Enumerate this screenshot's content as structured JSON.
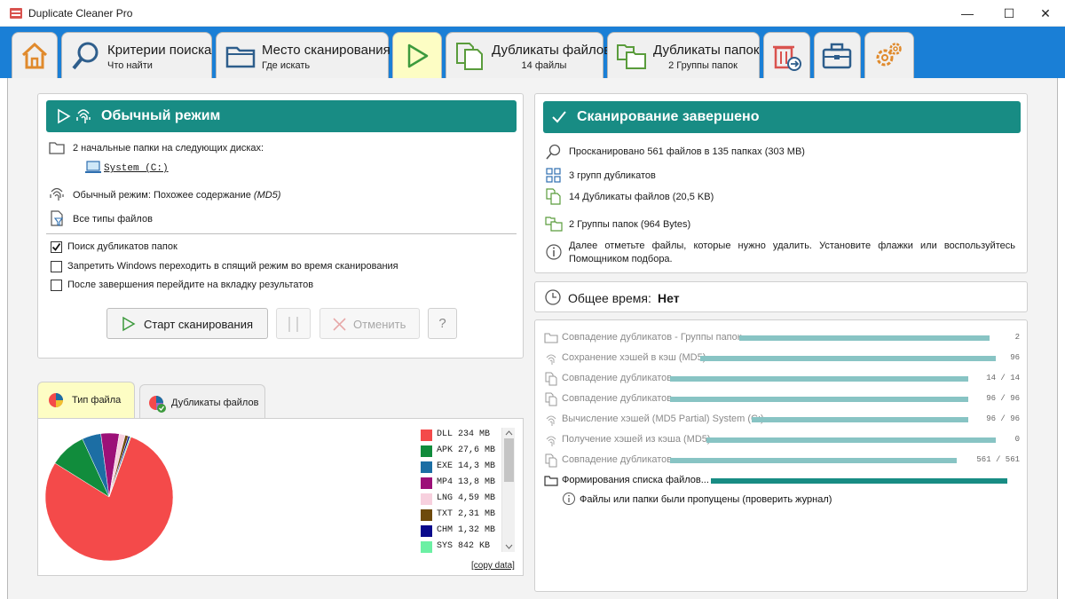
{
  "window": {
    "title": "Duplicate Cleaner Pro",
    "minimize": "—",
    "maximize": "☐",
    "close": "✕"
  },
  "tabs": {
    "search_criteria": {
      "title": "Критерии поиска",
      "subtitle": "Что найти"
    },
    "scan_location": {
      "title": "Место сканирования",
      "subtitle": "Где искать"
    },
    "duplicate_files": {
      "title": "Дубликаты файлов",
      "subtitle": "14 файлы"
    },
    "duplicate_folders": {
      "title": "Дубликаты папок",
      "subtitle": "2 Группы папок"
    }
  },
  "mode_panel": {
    "header": "Обычный режим",
    "start_folders": "2 начальные папки на следующих дисках:",
    "drive": "System (C:)",
    "mode_text": "Обычный режим: Похожее содержание",
    "mode_hash": "(MD5)",
    "file_types": "Все типы файлов",
    "options": [
      {
        "label": "Поиск дубликатов папок",
        "checked": true
      },
      {
        "label": "Запретить Windows переходить в спящий режим во время сканирования",
        "checked": false
      },
      {
        "label": "После завершения перейдите на вкладку результатов",
        "checked": false
      }
    ],
    "start_button": "Старт сканирования",
    "cancel_button": "Отменить",
    "help_button": "?"
  },
  "scan_panel": {
    "header": "Сканирование завершено",
    "scanned": "Просканировано 561 файлов в 135 папках (303 MB)",
    "groups": "3 групп дубликатов",
    "dup_files": "14 Дубликаты файлов (20,5 KB)",
    "dup_folders": "2 Группы папок (964 Bytes)",
    "info": "Далее отметьте файлы, которые нужно удалить. Установите флажки или воспользуйтесь Помощником подбора."
  },
  "time_panel": {
    "label": "Общее время:",
    "value": "Нет"
  },
  "progress": {
    "items": [
      {
        "icon": "folder-icon",
        "label": "Совпадение дубликатов - Группы папок",
        "fill": 1.0,
        "value": "2"
      },
      {
        "icon": "fingerprint-icon",
        "label": "Сохранение хэшей в кэш (MD5)",
        "fill": 1.0,
        "value": "96"
      },
      {
        "icon": "copy-icon",
        "label": "Совпадение дубликатов",
        "fill": 1.0,
        "value": "14 / 14"
      },
      {
        "icon": "copy-icon",
        "label": "Совпадение дубликатов",
        "fill": 1.0,
        "value": "96 / 96"
      },
      {
        "icon": "fingerprint-icon",
        "label": "Вычисление хэшей (MD5 Partial) System (C:)",
        "fill": 1.0,
        "value": "96 / 96"
      },
      {
        "icon": "fingerprint-icon",
        "label": "Получение хэшей из кэша (MD5)",
        "fill": 1.0,
        "value": "0"
      },
      {
        "icon": "copy-icon",
        "label": "Совпадение дубликатов",
        "fill": 1.0,
        "value": "561 / 561"
      }
    ],
    "current": {
      "label": "Формирования списка файлов...",
      "fill": 1.0
    },
    "skipped_note": "Файлы или папки были пропущены (проверить журнал)"
  },
  "chart_tabs": {
    "file_type": "Тип файла",
    "duplicate_files": "Дубликаты файлов"
  },
  "chart_data": {
    "type": "pie",
    "unit_note": "",
    "series": [
      {
        "name": "DLL",
        "size": "234 MB",
        "value": 234,
        "color": "#f44a4a"
      },
      {
        "name": "APK",
        "size": "27,6 MB",
        "value": 27.6,
        "color": "#118c3c"
      },
      {
        "name": "EXE",
        "size": "14,3 MB",
        "value": 14.3,
        "color": "#1c6ea4"
      },
      {
        "name": "MP4",
        "size": "13,8 MB",
        "value": 13.8,
        "color": "#9c1078"
      },
      {
        "name": "LNG",
        "size": "4,59 MB",
        "value": 4.59,
        "color": "#f7d0de"
      },
      {
        "name": "TXT",
        "size": "2,31 MB",
        "value": 2.31,
        "color": "#6e4a0c"
      },
      {
        "name": "CHM",
        "size": "1,32 MB",
        "value": 1.32,
        "color": "#0a0a8c"
      },
      {
        "name": "SYS",
        "size": "842 KB",
        "value": 0.82,
        "color": "#6cf0a4"
      }
    ],
    "copy_link": "[copy data]"
  },
  "colors": {
    "accent_blue": "#1a7fd6",
    "teal": "#188c84",
    "active_tab": "#fdfdc4",
    "progress": "#88c4c4"
  }
}
